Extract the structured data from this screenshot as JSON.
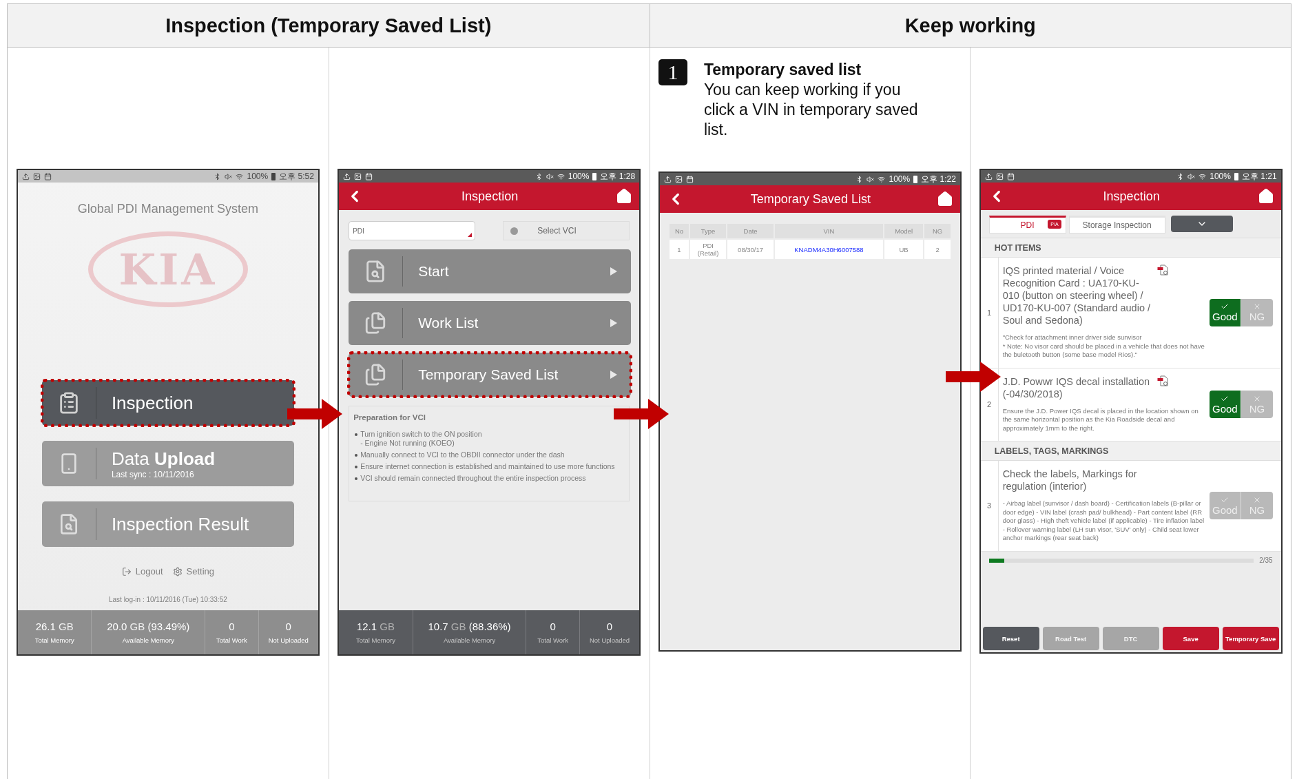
{
  "sections": [
    {
      "title": "Inspection (Temporary Saved List)"
    },
    {
      "title": "Keep working"
    }
  ],
  "step": {
    "number": "1",
    "title": "Temporary saved list",
    "body": "You can keep working if you click a VIN in temporary saved list."
  },
  "screens": [
    {
      "kind": "home",
      "dimmed": true,
      "status": {
        "battery": "100%",
        "time": "오후 5:52"
      },
      "title": "Global PDI Management System",
      "logo": "KIA",
      "menu": [
        {
          "label": "Inspection",
          "highlighted": true
        },
        {
          "label": "Data **Upload**",
          "sublabel": "Last sync : 10/11/2016",
          "highlighted": false
        },
        {
          "label": "Inspection Result",
          "highlighted": false
        }
      ],
      "links": [
        "Logout",
        "Setting"
      ],
      "last_login": "Last log-in : 10/11/2016 (Tue) 10:33:52",
      "stats": [
        {
          "value": "26.1",
          "unit": "GB",
          "label": "Total Memory"
        },
        {
          "value": "20.0",
          "unit": "GB",
          "extra": "(93.49%)",
          "label": "Available Memory"
        },
        {
          "value": "0",
          "label": "Total Work"
        },
        {
          "value": "0",
          "label": "Not Uploaded"
        }
      ]
    },
    {
      "kind": "menu",
      "dimmed": false,
      "status": {
        "battery": "100%",
        "time": "오후 1:28"
      },
      "title": "Inspection",
      "dropdown": {
        "value": "PDI"
      },
      "vci_button": "Select VCI",
      "menu": [
        {
          "label": "Start",
          "highlighted": false
        },
        {
          "label": "Work List",
          "highlighted": false
        },
        {
          "label": "Temporary Saved List",
          "highlighted": true
        }
      ],
      "info": {
        "title": "Preparation for VCI",
        "bullets": [
          {
            "text": "Turn ignition switch to the ON position",
            "sub": "- Engine Not running (KOEO)"
          },
          {
            "text": "Manually connect to VCI to the OBDII connector under the dash"
          },
          {
            "text": "Ensure internet connection is established and maintained to use more functions"
          },
          {
            "text": "VCI should remain connected throughout the entire inspection process"
          }
        ]
      },
      "stats": [
        {
          "value": "12.1",
          "unit": "GB",
          "label": "Total Memory"
        },
        {
          "value": "10.7",
          "unit": "GB",
          "extra": "(88.36%)",
          "label": "Available Memory"
        },
        {
          "value": "0",
          "label": "Total Work"
        },
        {
          "value": "0",
          "label": "Not Uploaded"
        }
      ]
    },
    {
      "kind": "list",
      "status": {
        "battery": "100%",
        "time": "오후 1:22"
      },
      "title": "Temporary Saved List",
      "table": {
        "columns": [
          "No",
          "Type",
          "Date",
          "VIN",
          "Model",
          "NG"
        ],
        "rows": [
          [
            "1",
            "PDI (Retail)",
            "08/30/17",
            "KNADM4A30H6007588",
            "UB",
            "2"
          ]
        ]
      }
    },
    {
      "kind": "checklist",
      "status": {
        "battery": "100%",
        "time": "오후 1:21"
      },
      "title": "Inspection",
      "tabs": [
        {
          "label": "PDI",
          "badge": "P/A",
          "selected": true
        },
        {
          "label": "Storage Inspection",
          "selected": false
        }
      ],
      "sections": [
        {
          "title": "HOT ITEMS",
          "items": [
            {
              "no": "1",
              "title": "IQS printed material / Voice Recognition Card : UA170-KU-010 (button on steering wheel) / UD170-KU-007 (Standard audio / Soul and Sedona)",
              "note": "\"Check for attachment inner driver side sunvisor\n* Note: No visor card should be placed in a vehicle that does not have the buletooth button (some base model Rios).\"",
              "pdf": true,
              "choices": [
                {
                  "label": "Good",
                  "selected": true
                },
                {
                  "label": "NG",
                  "selected": false
                }
              ]
            },
            {
              "no": "2",
              "title": "J.D. Powwr IQS decal installation (-04/30/2018)",
              "note": "Ensure the J.D. Power IQS decal is placed in the location shown on the same horizontal position as the Kia Roadside decal and approximately 1mm to the right.",
              "pdf": true,
              "choices": [
                {
                  "label": "Good",
                  "selected": true
                },
                {
                  "label": "NG",
                  "selected": false
                }
              ]
            }
          ]
        },
        {
          "title": "LABELS, TAGS, MARKINGS",
          "items": [
            {
              "no": "3",
              "title": "Check the labels, Markings for regulation (interior)",
              "note": "- Airbag label (sunvisor / dash board) - Certification labels (B-pillar or door edge) - VIN label (crash pad/ bulkhead) - Part content label (RR door glass) - High theft vehicle label (if applicable) - Tire inflation label - Rollover warning label (LH sun visor, 'SUV' only) - Child seat lower anchor markings (rear seat back)",
              "pdf": false,
              "choices": [
                {
                  "label": "Good",
                  "selected": false
                },
                {
                  "label": "NG",
                  "selected": false
                }
              ]
            }
          ]
        }
      ],
      "progress": {
        "level": 0.057,
        "text": "2/35"
      },
      "buttons": [
        {
          "label": "Reset",
          "kind": "dark"
        },
        {
          "label": "Road Test",
          "kind": "disabled"
        },
        {
          "label": "DTC",
          "kind": "disabled"
        },
        {
          "label": "Save",
          "kind": "primary"
        },
        {
          "label": "Temporary Save",
          "kind": "primary"
        }
      ]
    }
  ]
}
